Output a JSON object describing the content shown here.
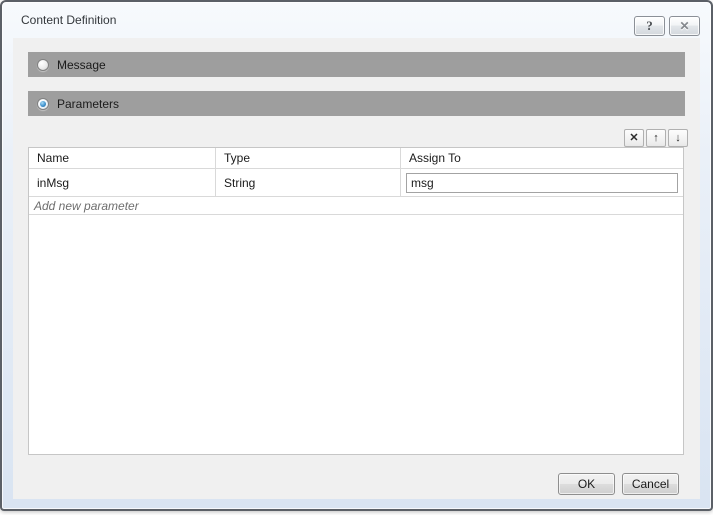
{
  "window": {
    "title": "Content Definition"
  },
  "icons": {
    "help": "?",
    "close": "✕",
    "delete": "✕",
    "move_up": "↑",
    "move_down": "↓"
  },
  "sections": [
    {
      "label": "Message",
      "selected": false
    },
    {
      "label": "Parameters",
      "selected": true
    }
  ],
  "table": {
    "columns": [
      "Name",
      "Type",
      "Assign To"
    ],
    "rows": [
      {
        "name": "inMsg",
        "type": "String",
        "assign_to": "msg"
      }
    ],
    "add_row_placeholder": "Add new parameter"
  },
  "footer": {
    "ok_label": "OK",
    "cancel_label": "Cancel"
  },
  "colors": {
    "section_bar": "#9e9e9e",
    "radio_selected": "#3f93cf",
    "content_background": "#f0f0f0",
    "frame_gradient_bottom": "#d9e4f2",
    "table_border": "#c6c6c6"
  }
}
